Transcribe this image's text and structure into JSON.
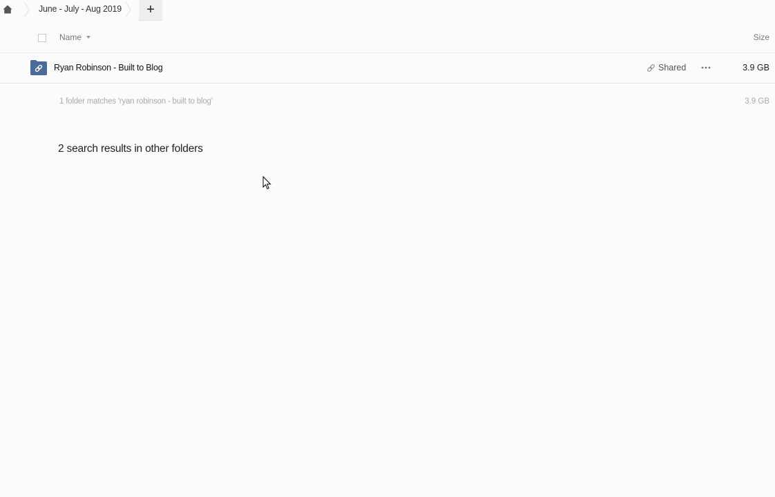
{
  "breadcrumb": {
    "home_icon": "home-icon",
    "folder_label": "June - July - Aug 2019",
    "add_label": "+"
  },
  "table": {
    "columns": {
      "name": "Name",
      "size": "Size"
    },
    "rows": [
      {
        "icon": "shared-folder-link-icon",
        "name": "Ryan Robinson - Built to Blog",
        "shared_label": "Shared",
        "size": "3.9 GB"
      }
    ],
    "summary": {
      "text": "1 folder matches 'ryan robinson - built to blog'",
      "size": "3.9 GB"
    }
  },
  "other_results": {
    "heading": "2 search results in other folders"
  },
  "colors": {
    "folder_icon": "#4a6a99",
    "background": "#fbfbfb"
  }
}
